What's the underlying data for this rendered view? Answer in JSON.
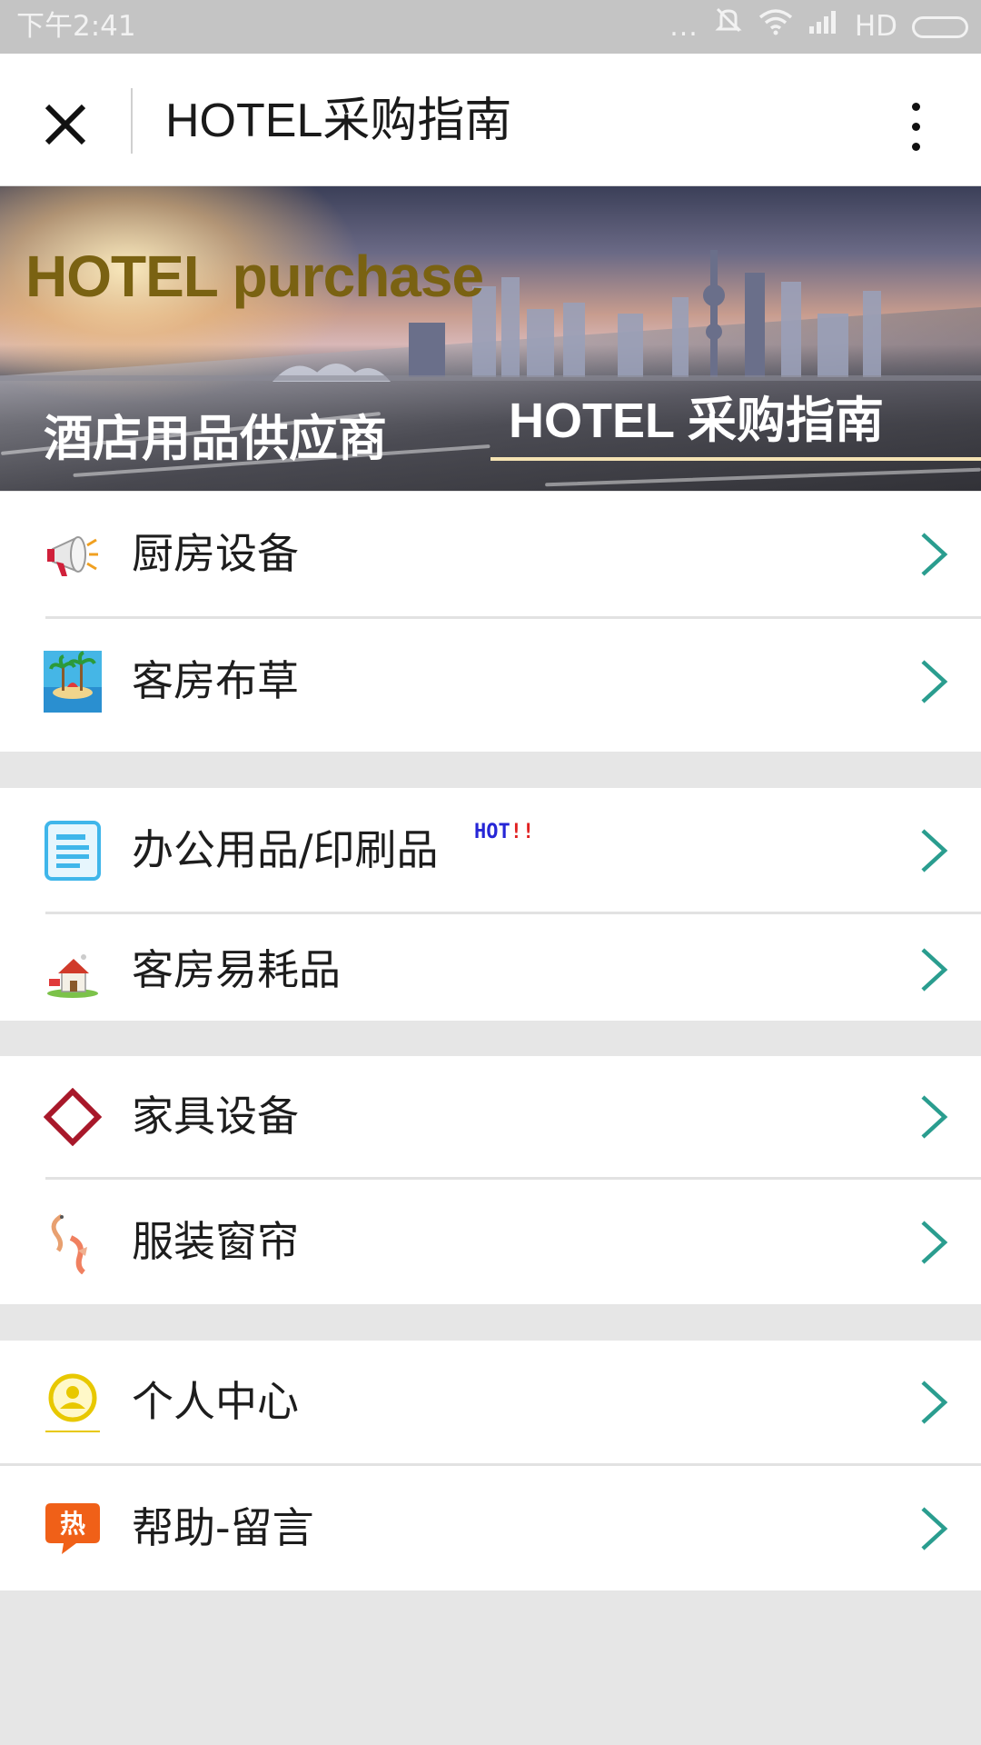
{
  "status_bar": {
    "time": "下午2:41",
    "dots": "...",
    "network": "HD"
  },
  "header": {
    "title": "HOTEL采购指南",
    "close_icon": "close-icon",
    "more_icon": "more-vertical-icon"
  },
  "banner": {
    "title_en": "HOTEL purchase",
    "subtitle_cn": "酒店用品供应商",
    "title_right": "HOTEL 采购指南"
  },
  "menu": {
    "group1": [
      {
        "label": "厨房设备",
        "icon": "megaphone-icon"
      },
      {
        "label": "客房布草",
        "icon": "beach-island-icon"
      }
    ],
    "group2": [
      {
        "label": "办公用品/印刷品",
        "icon": "document-icon",
        "badge_text": "HOT",
        "badge_mark": "!!"
      },
      {
        "label": "客房易耗品",
        "icon": "house-icon"
      }
    ],
    "group3": [
      {
        "label": "家具设备",
        "icon": "diamond-icon"
      },
      {
        "label": "服装窗帘",
        "icon": "koi-fish-icon"
      }
    ],
    "group4": [
      {
        "label": "个人中心",
        "icon": "user-circle-icon"
      },
      {
        "label": "帮助-留言",
        "icon": "hot-chat-icon",
        "icon_text": "热"
      }
    ]
  },
  "colors": {
    "chevron": "#2a9d8f",
    "background": "#e6e6e6",
    "status_bar": "#c4c4c4",
    "banner_title": "#7a6212"
  }
}
